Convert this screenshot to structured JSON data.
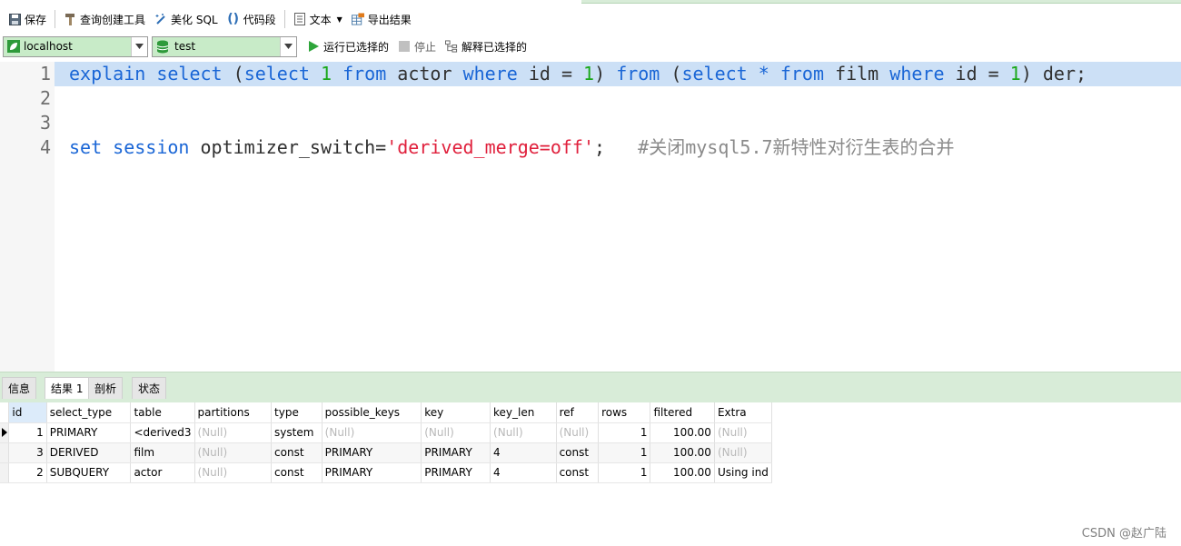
{
  "toolbar": {
    "save": "保存",
    "query_builder": "查询创建工具",
    "beautify_sql": "美化 SQL",
    "code_snippet": "代码段",
    "text_mode": "文本",
    "export_results": "导出结果"
  },
  "connection": {
    "host": "localhost",
    "database": "test",
    "run_selected": "运行已选择的",
    "stop": "停止",
    "explain_selected": "解释已选择的"
  },
  "editor": {
    "line_numbers": [
      "1",
      "2",
      "3",
      "4"
    ],
    "line1": {
      "t1": "explain",
      "t2": "select",
      "t3": "(",
      "t4": "select",
      "t5": "1",
      "t6": "from",
      "t7": "actor",
      "t8": "where",
      "t9": "id =",
      "t10": "1",
      "t11": ")",
      "t12": "from",
      "t13": "(",
      "t14": "select",
      "t15": "*",
      "t16": "from",
      "t17": "film",
      "t18": "where",
      "t19": "id =",
      "t20": "1",
      "t21": ") der;"
    },
    "line4": {
      "kw1": "set",
      "kw2": "session",
      "ident": "optimizer_switch=",
      "str": "'derived_merge=off'",
      "semi": ";",
      "comment": "#关闭mysql5.7新特性对衍生表的合并"
    }
  },
  "tabs": [
    "信息",
    "结果 1",
    "剖析",
    "状态"
  ],
  "results": {
    "columns": [
      "id",
      "select_type",
      "table",
      "partitions",
      "type",
      "possible_keys",
      "key",
      "key_len",
      "ref",
      "rows",
      "filtered",
      "Extra"
    ],
    "rows": [
      [
        "1",
        "PRIMARY",
        "<derived3",
        "(Null)",
        "system",
        "(Null)",
        "(Null)",
        "(Null)",
        "(Null)",
        "1",
        "100.00",
        "(Null)"
      ],
      [
        "3",
        "DERIVED",
        "film",
        "(Null)",
        "const",
        "PRIMARY",
        "PRIMARY",
        "4",
        "const",
        "1",
        "100.00",
        "(Null)"
      ],
      [
        "2",
        "SUBQUERY",
        "actor",
        "(Null)",
        "const",
        "PRIMARY",
        "PRIMARY",
        "4",
        "const",
        "1",
        "100.00",
        "Using ind"
      ]
    ]
  },
  "watermark": "CSDN @赵广陆",
  "colors": {
    "keyword": "#1a66d6",
    "number": "#1aa81a",
    "string": "#e0203c",
    "comment": "#8a8a8a",
    "selection": "#cce0f6",
    "panel_green": "#d8ecd8",
    "combo_green": "#c8ebc8"
  },
  "icons": {
    "save": "floppy-disk-icon",
    "query_builder": "hammer-icon",
    "beautify": "magic-wand-icon",
    "snippet": "parentheses-icon",
    "text": "document-icon",
    "export": "export-grid-icon",
    "host": "server-leaf-icon",
    "database": "database-cylinder-icon",
    "run": "play-icon",
    "stop": "stop-square-icon",
    "explain": "explain-tree-icon",
    "row_pointer": "row-pointer-icon"
  }
}
